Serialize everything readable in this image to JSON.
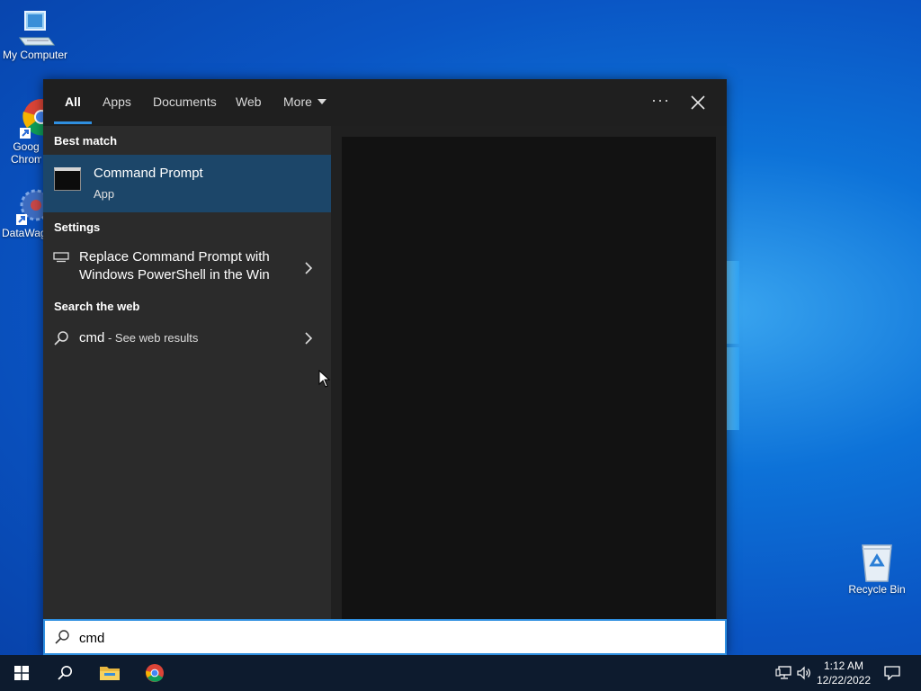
{
  "desktop": {
    "icons": [
      {
        "label": "My Computer"
      },
      {
        "label": "Goog Chrom"
      },
      {
        "label": "DataWag"
      },
      {
        "label": "Recycle Bin"
      }
    ]
  },
  "search_panel": {
    "tabs": [
      {
        "label": "All",
        "active": true
      },
      {
        "label": "Apps"
      },
      {
        "label": "Documents"
      },
      {
        "label": "Web"
      },
      {
        "label": "More"
      }
    ],
    "more_options_label": "···",
    "sections": {
      "best_match": "Best match",
      "settings": "Settings",
      "search_web": "Search the web"
    },
    "best_match": {
      "title": "Command Prompt",
      "subtitle": "App"
    },
    "settings_item": {
      "line1": "Replace Command Prompt with",
      "line2": "Windows PowerShell in the Win"
    },
    "web_item": {
      "query": "cmd",
      "suffix": " - See web results"
    }
  },
  "search_box": {
    "value": "cmd"
  },
  "taskbar": {
    "time": "1:12 AM",
    "date": "12/22/2022"
  },
  "colors": {
    "accent": "#2f8fe0",
    "best_match_bg": "#1c4669",
    "panel_bg": "#202020",
    "taskbar_bg": "#0d1b2e"
  }
}
